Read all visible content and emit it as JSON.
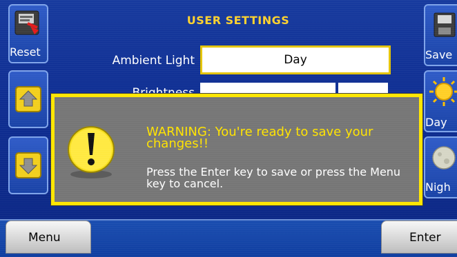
{
  "header": {
    "title": "USER SETTINGS"
  },
  "left_buttons": {
    "reset_label": "Reset"
  },
  "right_buttons": {
    "save_label": "Save",
    "day_label": "Day",
    "night_label": "Nigh"
  },
  "settings": {
    "ambient_light": {
      "label": "Ambient Light",
      "value": "Day"
    },
    "brightness": {
      "label": "Brightness"
    }
  },
  "dialog": {
    "title": "WARNING: You're ready to save your changes!!",
    "body": "Press the Enter key to save or press the Menu key to cancel.",
    "icon": "exclamation-icon"
  },
  "bottom_bar": {
    "menu_label": "Menu",
    "enter_label": "Enter"
  },
  "colors": {
    "accent_yellow": "#ffe300",
    "panel_gray": "#767676",
    "screen_blue": "#0f2e92"
  }
}
